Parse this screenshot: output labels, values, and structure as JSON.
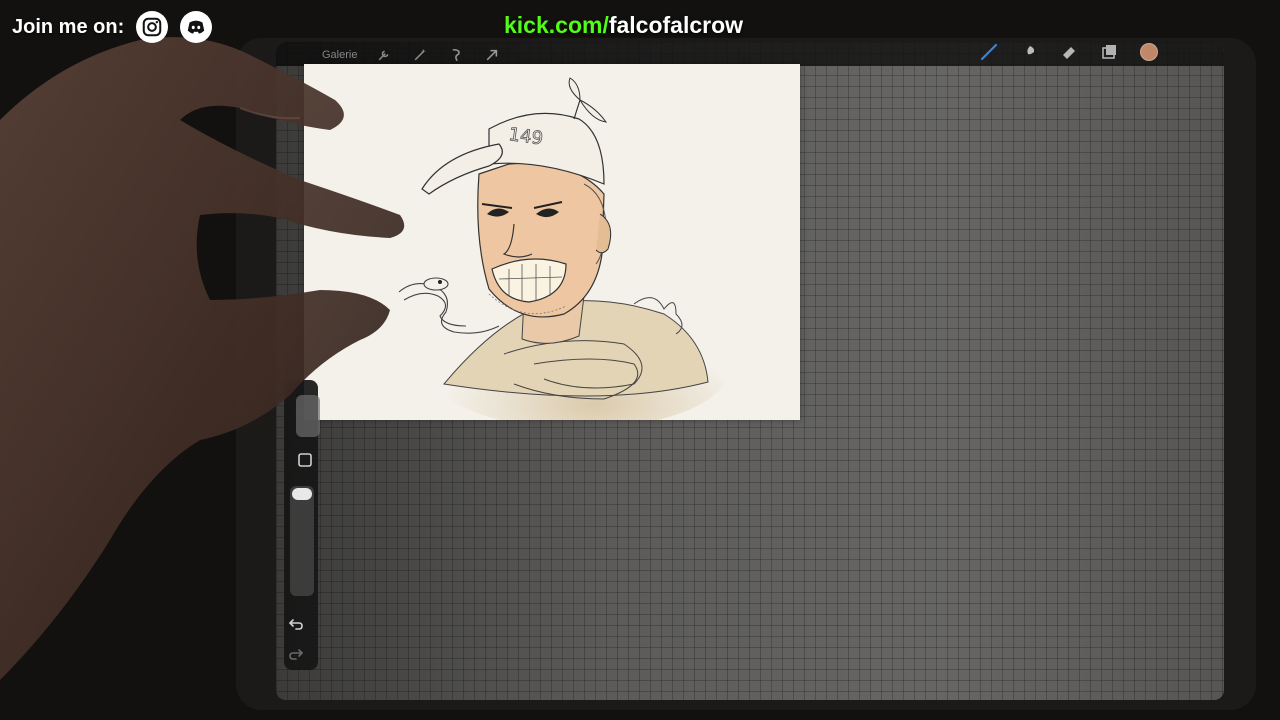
{
  "overlay": {
    "join_label": "Join me on:",
    "socials": [
      {
        "icon": "instagram-icon"
      },
      {
        "icon": "discord-icon"
      }
    ],
    "kick_domain": "kick.com/",
    "kick_user": "falcofalcrow",
    "kick_color": "#53fc18"
  },
  "app": {
    "topbar": {
      "gallery_label": "Galerie",
      "left_tools": [
        "wrench-icon",
        "magic-wand-icon",
        "selection-icon",
        "transform-arrow-icon"
      ],
      "right_tools": [
        "brush-icon",
        "smudge-icon",
        "eraser-icon",
        "layers-icon",
        "color-swatch"
      ],
      "active_color": "#e6a27b",
      "accent_color": "#3a8ff0"
    },
    "sidebar": {
      "tools": [
        "brush-size-slider",
        "modify-square-icon",
        "opacity-slider",
        "undo-icon",
        "redo-icon"
      ]
    },
    "canvas": {
      "cap_number": "149",
      "background": "#f4f1ea"
    }
  }
}
